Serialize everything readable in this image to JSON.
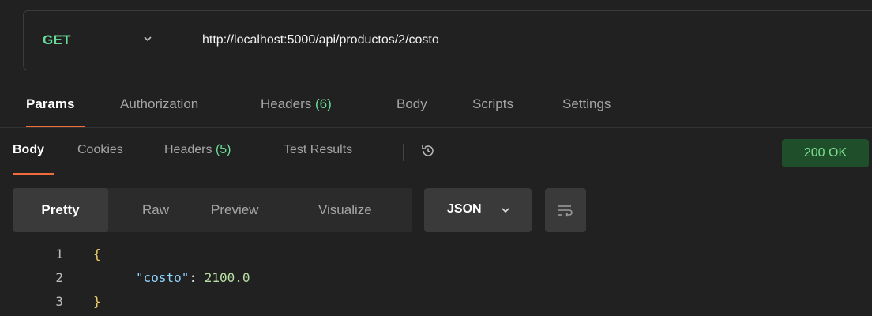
{
  "request": {
    "method": "GET",
    "url": "http://localhost:5000/api/productos/2/costo"
  },
  "request_tabs": [
    {
      "label": "Params",
      "active": true
    },
    {
      "label": "Authorization"
    },
    {
      "label": "Headers",
      "count": "(6)"
    },
    {
      "label": "Body"
    },
    {
      "label": "Scripts"
    },
    {
      "label": "Settings"
    }
  ],
  "response_tabs": [
    {
      "label": "Body",
      "active": true
    },
    {
      "label": "Cookies"
    },
    {
      "label": "Headers",
      "count": "(5)"
    },
    {
      "label": "Test Results"
    }
  ],
  "status": "200 OK",
  "format_options": [
    "Pretty",
    "Raw",
    "Preview",
    "Visualize"
  ],
  "language": "JSON",
  "code": {
    "line_numbers": [
      "1",
      "2",
      "3"
    ],
    "open_brace": "{",
    "key": "\"costo\"",
    "colon": ":",
    "value": "2100.0",
    "close_brace": "}"
  },
  "colors": {
    "method": "#6bdd9a",
    "accent_underline": "#f26b3a",
    "status_bg": "#1f4f2a",
    "status_text": "#7de08f",
    "json_key": "#8fd3ff",
    "json_number": "#b8e0a3"
  },
  "icons": {
    "method_dropdown": "chevron-down-icon",
    "history": "history-icon",
    "language_dropdown": "chevron-down-icon",
    "wrap": "wrap-lines-icon"
  }
}
